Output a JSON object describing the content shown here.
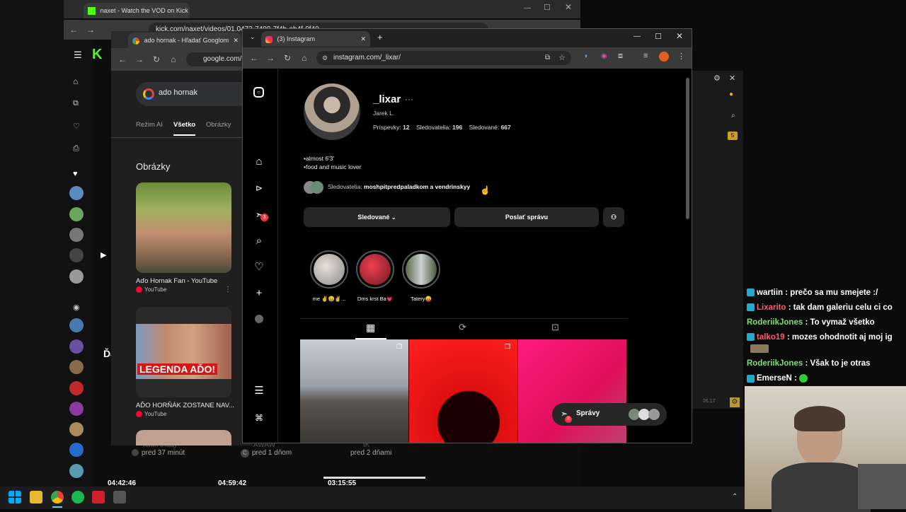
{
  "kick_window": {
    "tab_title": "naxet - Watch the VOD on Kick",
    "url": "kick.com/naxet/videos/01.0473-7490-7f4b-ab4f-0f40..."
  },
  "kick_page": {
    "bottom_meta": [
      {
        "title": "Tokin friday",
        "age": "pred 37 minút"
      },
      {
        "title": "AWAW",
        "age": "pred 1 dňom",
        "badge": "C"
      },
      {
        "title": "IK",
        "age": "pred 2 dňami"
      }
    ],
    "durations": [
      "04:42:46",
      "04:59:42",
      "03:15:55"
    ],
    "partial_text": "Ďa"
  },
  "google_window": {
    "tab_title": "ado hornak - Hľadať Googlom",
    "url": "google.com/s",
    "search_query": "ado hornak",
    "filters": [
      "Režim AI",
      "Všetko",
      "Obrázky"
    ],
    "active_filter": "Všetko",
    "section_title": "Obrázky",
    "results": [
      {
        "title": "Aďo Hornak Fan - YouTube",
        "source": "YouTube"
      },
      {
        "title": "AĎO HORŇÁK ZOSTANE NAV...",
        "source": "YouTube",
        "thumb_caption": "LEGENDA AĎO!"
      }
    ]
  },
  "instagram_window": {
    "tab_title": "(3) Instagram",
    "url": "instagram.com/_lixar/"
  },
  "instagram": {
    "username": "_lixar",
    "full_name": "Jarek L.",
    "stats": [
      {
        "label": "Príspevky: ",
        "value": "12"
      },
      {
        "label": "Sledovatelia: ",
        "value": "196"
      },
      {
        "label": "Sledované: ",
        "value": "667"
      }
    ],
    "bio": [
      "•almost 6'3'",
      "•food and music lover"
    ],
    "followed_by": {
      "prefix": "Sledovatelia: ",
      "names": "moshpitpredpaladkom a vendrinskyy"
    },
    "buttons": {
      "following": "Sledované",
      "message": "Poslať správu"
    },
    "highlights": [
      "me ✌️😄✌️...",
      "Dms krst Ba💗",
      "Tatery😛"
    ],
    "notif_count": "3",
    "messages_button": "Správy",
    "messages_count": "3"
  },
  "chat": [
    {
      "user": "wartiin",
      "text": "prečo sa mu smejete :/",
      "color": "#ffffff"
    },
    {
      "user": "Lixarito",
      "text": "tak dam galeriu celu ci co",
      "color": "#ff5a6e"
    },
    {
      "user": "RoderiikJones",
      "text": "To vymaž všetko",
      "color": "#7ee06e"
    },
    {
      "user": "talko19",
      "text": "mozes ohodnotit aj moj ig",
      "color": "#ff5a6e"
    },
    {
      "user": "RoderiikJones",
      "text": "Však to je otras",
      "color": "#7ee06e"
    },
    {
      "user": "EmerseN",
      "text": "",
      "color": "#ffffff"
    }
  ],
  "right_panel": {
    "badge": "5",
    "small_text": "26.17"
  },
  "colors": {
    "kick_green": "#53fc18",
    "ig_bg": "#000000",
    "chrome_dark": "#3a3a3a",
    "notif_red": "#ff3040"
  }
}
